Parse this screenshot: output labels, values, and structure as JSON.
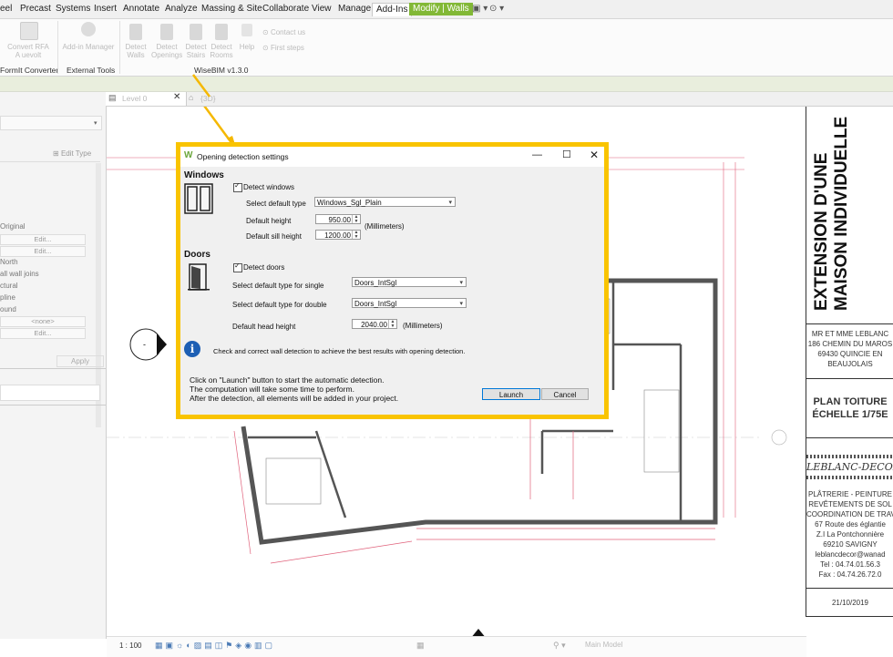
{
  "ribbon": {
    "tabs": [
      "eel",
      "Precast",
      "Systems",
      "Insert",
      "Annotate",
      "Analyze",
      "Massing & Site",
      "Collaborate",
      "View",
      "Manage",
      "Add-Ins",
      "Modify | Walls"
    ],
    "buttons": {
      "convert_rfa": "Convert RFA\nA uevolt",
      "add_in_manager": "Add-in Manager",
      "detect_walls": "Detect\nWalls",
      "detect_openings": "Detect\nOpenings",
      "detect_stairs": "Detect\nStairs",
      "detect_rooms": "Detect\nRooms",
      "help": "Help",
      "contact_us": "Contact us",
      "first_steps": "First steps"
    },
    "groups": {
      "formit": "FormIt Converter",
      "external_tools": "External Tools",
      "wisebim": "WiseBIM v1.3.0"
    }
  },
  "left_panel": {
    "edit_type": "Edit Type",
    "items": [
      "Original",
      "Edit...",
      "Edit...",
      "North",
      "all wall joins",
      "ctural",
      "pline",
      "ound",
      "<none>",
      "Edit..."
    ],
    "apply": "Apply"
  },
  "view_tabs": {
    "tab1": "Level 0",
    "tab2": "{3D}"
  },
  "view_bar": {
    "scale": "1 : 100"
  },
  "status_bar": {
    "main_model": "Main Model"
  },
  "title_block": {
    "project_title": "EXTENSION D'UNE MAISON INDIVIDUELLE",
    "client_lines": [
      "MR ET MME LEBLANC",
      "186 CHEMIN DU MAROS",
      "69430 QUINCIE EN",
      "BEAUJOLAIS"
    ],
    "plan_title": "PLAN TOITURE",
    "scale": "ÉCHELLE 1/75E",
    "company": "LEBLANC-DECOR",
    "company_lines": [
      "PLÂTRERIE - PEINTURE",
      "REVÊTEMENTS DE SOL",
      "COORDINATION DE TRAV",
      "67 Route des églantie",
      "Z.I La Pontchonnière",
      "69210 SAVIGNY",
      "leblancdecor@wanad",
      "Tel : 04.74.01.56.3",
      "Fax : 04.74.26.72.0"
    ],
    "date": "21/10/2019"
  },
  "dialog": {
    "title": "Opening detection settings",
    "windows_heading": "Windows",
    "detect_windows": "Detect windows",
    "select_default_type_label": "Select default type",
    "window_type": "Windows_Sgl_Plain",
    "default_height_label": "Default height",
    "default_height": "950.00",
    "units": "(Millimeters)",
    "default_sill_height_label": "Default sill height",
    "default_sill_height": "1200.00",
    "doors_heading": "Doors",
    "detect_doors": "Detect doors",
    "single_label": "Select default type for single",
    "single_type": "Doors_IntSgl",
    "double_label": "Select default type for double",
    "double_type": "Doors_IntSgl",
    "head_height_label": "Default head height",
    "head_height": "2040.00",
    "info": "Check and correct wall detection to achieve the best results with opening detection.",
    "footer_lines": [
      "Click on \"Launch\" button to start the automatic detection.",
      "The computation will take some time to perform.",
      "After the detection, all elements will be added in your project."
    ],
    "launch": "Launch",
    "cancel": "Cancel"
  },
  "colors": {
    "highlight_frame": "#f9c400",
    "modify_tab": "#82b836",
    "dimension_red": "#e0607a",
    "wall_gray": "#555555"
  }
}
